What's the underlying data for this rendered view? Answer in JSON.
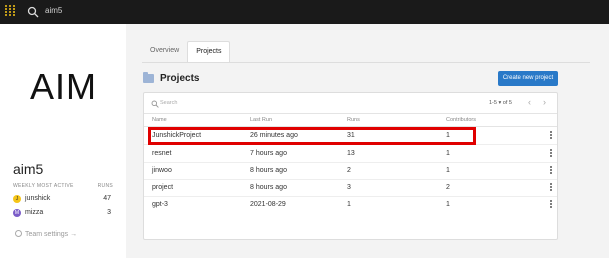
{
  "topbar": {
    "search_value": "aim5"
  },
  "sidebar": {
    "logo_text": "AIM",
    "entity_name": "aim5",
    "weekly_label": "WEEKLY MOST ACTIVE",
    "runs_label": "RUNS",
    "users": [
      {
        "initial": "J",
        "name": "junshick",
        "runs": "47",
        "color": "#f5c518"
      },
      {
        "initial": "M",
        "name": "mizza",
        "runs": "3",
        "color": "#7a5cc8"
      }
    ],
    "team_settings": "Team settings →"
  },
  "tabs": [
    {
      "label": "Overview"
    },
    {
      "label": "Projects"
    }
  ],
  "projects": {
    "title": "Projects",
    "create_button": "Create new project",
    "search_placeholder": "Search",
    "pager": "1-5 ▾ of 5",
    "columns": [
      "Name",
      "Last Run",
      "Runs",
      "Contributors"
    ],
    "rows": [
      {
        "name": "JunshickProject",
        "last_run": "26 minutes ago",
        "runs": "31",
        "contributors": "1"
      },
      {
        "name": "resnet",
        "last_run": "7 hours ago",
        "runs": "13",
        "contributors": "1"
      },
      {
        "name": "jinwoo",
        "last_run": "8 hours ago",
        "runs": "2",
        "contributors": "1"
      },
      {
        "name": "project",
        "last_run": "8 hours ago",
        "runs": "3",
        "contributors": "2"
      },
      {
        "name": "gpt-3",
        "last_run": "2021-08-29",
        "runs": "1",
        "contributors": "1"
      }
    ]
  },
  "colors": {
    "topbar": "#1a1a1a",
    "accent": "#2979c8",
    "highlight": "#e00000",
    "logo": "#f5c518"
  }
}
